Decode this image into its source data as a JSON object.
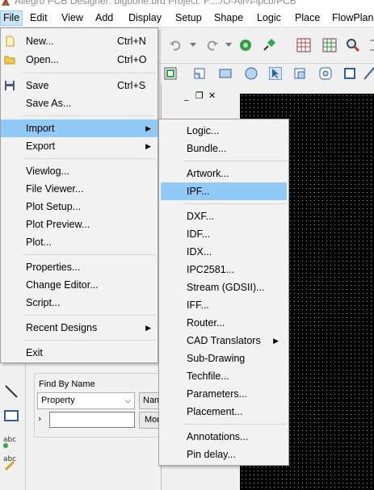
{
  "window": {
    "title": "Allegro PCB Designer: bigbone.brd  Project: F:.../O-All¼-lpcb/PCB"
  },
  "menubar": [
    {
      "label": "File",
      "active": true
    },
    {
      "label": "Edit"
    },
    {
      "label": "View"
    },
    {
      "label": "Add"
    },
    {
      "label": "Display"
    },
    {
      "label": "Setup"
    },
    {
      "label": "Shape"
    },
    {
      "label": "Logic"
    },
    {
      "label": "Place"
    },
    {
      "label": "FlowPlan"
    }
  ],
  "file_menu": {
    "items": [
      {
        "label": "New...",
        "accel": "Ctrl+N",
        "icon": "new-file-icon"
      },
      {
        "label": "Open...",
        "accel": "Ctrl+O",
        "icon": "open-folder-icon"
      },
      {
        "label": "Save",
        "accel": "Ctrl+S",
        "icon": "save-disk-icon"
      },
      {
        "label": "Save As..."
      },
      {
        "label": "Import",
        "submenu": true,
        "highlighted": true
      },
      {
        "label": "Export",
        "submenu": true
      },
      {
        "label": "Viewlog..."
      },
      {
        "label": "File Viewer..."
      },
      {
        "label": "Plot Setup..."
      },
      {
        "label": "Plot Preview..."
      },
      {
        "label": "Plot..."
      },
      {
        "label": "Properties..."
      },
      {
        "label": "Change Editor..."
      },
      {
        "label": "Script..."
      },
      {
        "label": "Recent Designs",
        "submenu": true
      },
      {
        "label": "Exit"
      }
    ]
  },
  "import_submenu": {
    "items": [
      {
        "label": "Logic..."
      },
      {
        "label": "Bundle..."
      },
      {
        "label": "Artwork..."
      },
      {
        "label": "IPF...",
        "highlighted": true
      },
      {
        "label": "DXF..."
      },
      {
        "label": "IDF..."
      },
      {
        "label": "IDX..."
      },
      {
        "label": "IPC2581..."
      },
      {
        "label": "Stream (GDSII)..."
      },
      {
        "label": "IFF..."
      },
      {
        "label": "Router..."
      },
      {
        "label": "CAD Translators",
        "submenu": true
      },
      {
        "label": "Sub-Drawing"
      },
      {
        "label": "Techfile..."
      },
      {
        "label": "Parameters..."
      },
      {
        "label": "Placement..."
      },
      {
        "label": "Annotations..."
      },
      {
        "label": "Pin delay..."
      }
    ]
  },
  "find_panel": {
    "group_label": "Find By Name",
    "type_select": "Property",
    "name_button": "Name",
    "more_button": "More",
    "value": ""
  },
  "colors": {
    "menu_highlight": "#91c9f7",
    "menubar_active": "#cce4f7",
    "canvas_bg": "#000000"
  }
}
